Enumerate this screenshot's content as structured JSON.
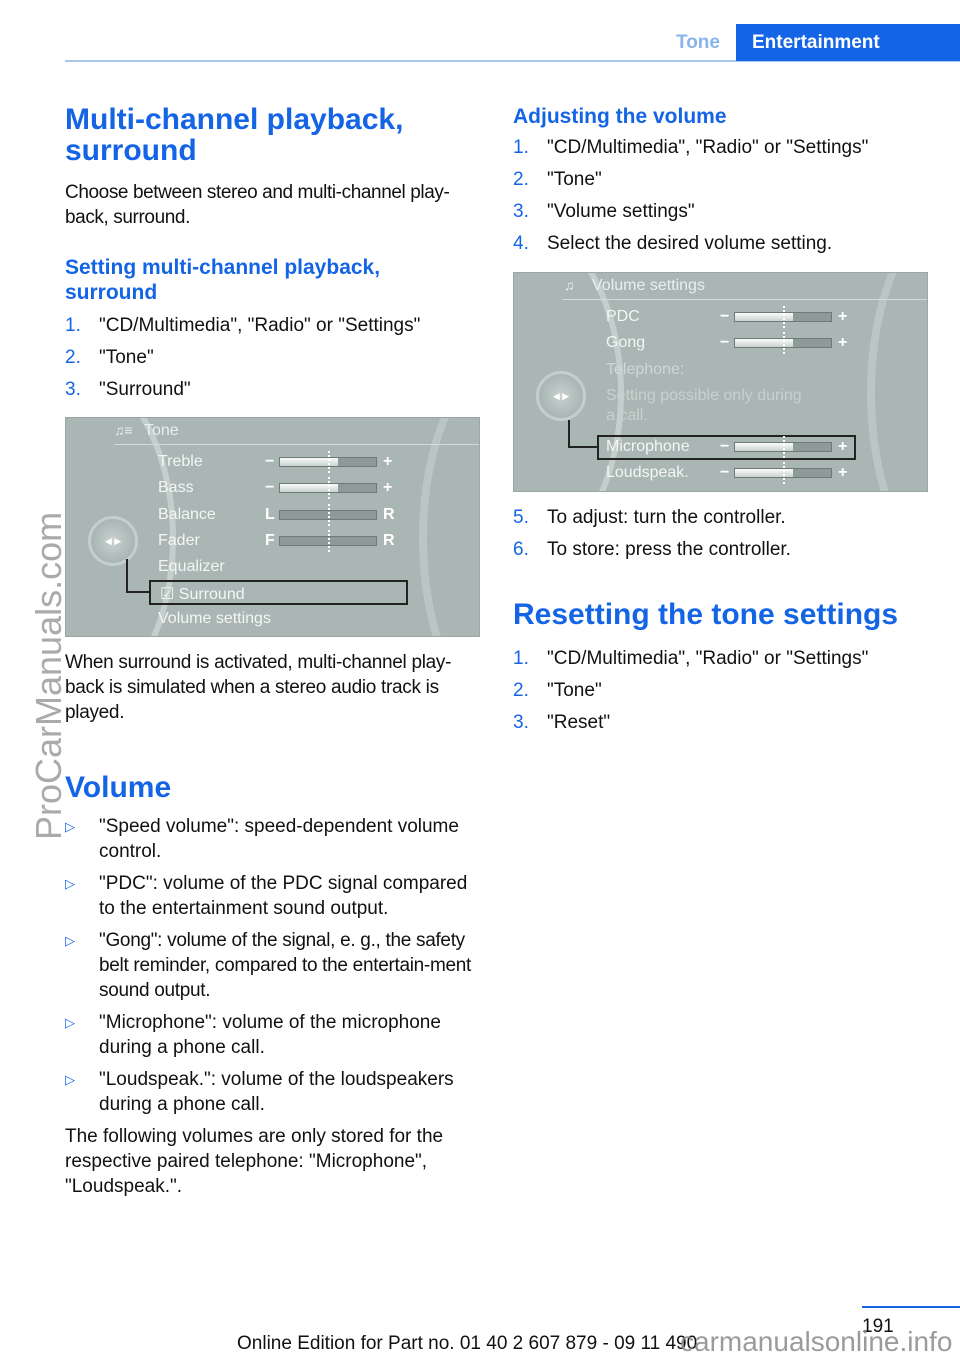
{
  "header": {
    "tab_section": "Tone",
    "tab_chapter": "Entertainment"
  },
  "left": {
    "title": "Multi-channel playback, surround",
    "intro": "Choose between stereo and multi-channel play-back, surround.",
    "sub_title": "Setting multi-channel playback, surround",
    "steps": [
      {
        "n": "1.",
        "t": "\"CD/Multimedia\", \"Radio\" or \"Settings\""
      },
      {
        "n": "2.",
        "t": "\"Tone\""
      },
      {
        "n": "3.",
        "t": "\"Surround\""
      }
    ],
    "screen": {
      "title": "Tone",
      "rows": [
        "Treble",
        "Bass",
        "Balance",
        "Fader",
        "Equalizer",
        "Surround",
        "Volume settings"
      ],
      "sliders": [
        {
          "l": "−",
          "r": "+",
          "level": 0.6
        },
        {
          "l": "−",
          "r": "+",
          "level": 0.6
        },
        {
          "l": "L",
          "r": "R",
          "level": 0.5
        },
        {
          "l": "F",
          "r": "R",
          "level": 0.5
        }
      ],
      "selected": "Surround"
    },
    "after": "When surround is activated, multi-channel play-back is simulated when a stereo audio track is played.",
    "volume_title": "Volume",
    "bullets": [
      "\"Speed volume\": speed-dependent volume control.",
      "\"PDC\": volume of the PDC signal compared to the entertainment sound output.",
      "\"Gong\": volume of the signal, e. g., the safety belt reminder, compared to the entertain-ment sound output.",
      "\"Microphone\": volume of the microphone during a phone call.",
      "\"Loudspeak.\": volume of the loudspeakers during a phone call."
    ],
    "bullet_glyph": "▷",
    "closing": "The following volumes are only stored for the respective paired telephone: \"Microphone\", \"Loudspeak.\"."
  },
  "right": {
    "title": "Adjusting the volume",
    "steps": [
      {
        "n": "1.",
        "t": "\"CD/Multimedia\", \"Radio\" or \"Settings\""
      },
      {
        "n": "2.",
        "t": "\"Tone\""
      },
      {
        "n": "3.",
        "t": "\"Volume settings\""
      },
      {
        "n": "4.",
        "t": "Select the desired volume setting."
      }
    ],
    "screen": {
      "title": "Volume settings",
      "pdc": "PDC",
      "gong": "Gong",
      "telephone": "Telephone:",
      "note1": "Setting possible only during",
      "note2": "a call.",
      "microphone": "Microphone",
      "loudspeak": "Loudspeak.",
      "minus": "−",
      "plus": "+",
      "level": 0.6,
      "selected": "Microphone"
    },
    "steps2": [
      {
        "n": "5.",
        "t": "To adjust: turn the controller."
      },
      {
        "n": "6.",
        "t": "To store: press the controller."
      }
    ],
    "reset_title": "Resetting the tone settings",
    "reset_steps": [
      {
        "n": "1.",
        "t": "\"CD/Multimedia\", \"Radio\" or \"Settings\""
      },
      {
        "n": "2.",
        "t": "\"Tone\""
      },
      {
        "n": "3.",
        "t": "\"Reset\""
      }
    ]
  },
  "footer": {
    "page": "191",
    "edition": "Online Edition for Part no. 01 40 2 607 879 - 09 11 490",
    "watermark": "carmanualsonline.info",
    "side_watermark": "ProCarManuals.com"
  },
  "colors": {
    "accent": "#1464e6",
    "screen_bg": "#a9b6b4"
  }
}
